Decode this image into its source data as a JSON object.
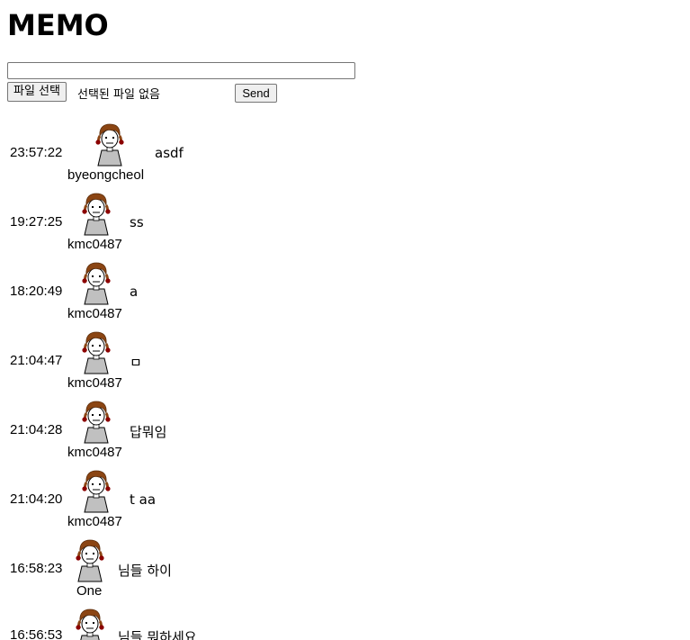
{
  "page": {
    "title": "MEMO"
  },
  "form": {
    "memo_input_value": "",
    "file_button_label": "파일 선택",
    "file_status": "선택된 파일 없음",
    "send_label": "Send"
  },
  "memos": [
    {
      "time": "23:57:22",
      "text": "asdf",
      "user": "byeongcheol"
    },
    {
      "time": "19:27:25",
      "text": "ss",
      "user": "kmc0487"
    },
    {
      "time": "18:20:49",
      "text": "a",
      "user": "kmc0487"
    },
    {
      "time": "21:04:47",
      "text": "ㅁ",
      "user": "kmc0487"
    },
    {
      "time": "21:04:28",
      "text": "답뭐임",
      "user": "kmc0487"
    },
    {
      "time": "21:04:20",
      "text": "t aa",
      "user": "kmc0487"
    },
    {
      "time": "16:58:23",
      "text": "님들 하이",
      "user": "One"
    },
    {
      "time": "16:56:53",
      "text": "님들 뭐하세요",
      "user": ""
    }
  ],
  "colors": {
    "hair": "#8b4513",
    "shirt": "#c0c0c0",
    "earring": "#8b0000"
  }
}
